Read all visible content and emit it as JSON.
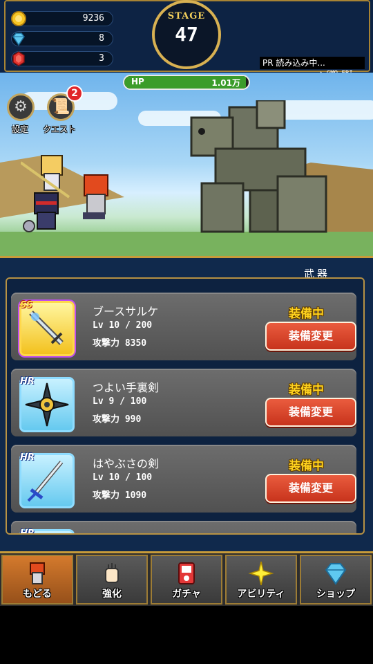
{
  "header": {
    "gold": "9236",
    "diamond": "8",
    "ruby": "3",
    "stage_label": "STAGE",
    "stage_number": "47",
    "pr_text": "PR 読み込み中...",
    "pr_logo": "▲ GMO-EBI"
  },
  "hp": {
    "label": "HP",
    "value": "1.01万",
    "fill_fraction": 0.98
  },
  "battle_buttons": {
    "settings_label": "設定",
    "quest_label": "クエスト",
    "quest_badge": "2"
  },
  "weapons_panel": {
    "title": "武器",
    "items": [
      {
        "rarity": "SS",
        "name": "ブースサルケ",
        "level": "Lv 10 / 200",
        "attack": "攻撃力 8350",
        "status": "装備中",
        "button": "装備変更"
      },
      {
        "rarity": "HR",
        "name": "つよい手裏剣",
        "level": "Lv 9 / 100",
        "attack": "攻撃力 990",
        "status": "装備中",
        "button": "装備変更"
      },
      {
        "rarity": "HR",
        "name": "はやぶさの剣",
        "level": "Lv 10 / 100",
        "attack": "攻撃力 1090",
        "status": "装備中",
        "button": "装備変更"
      },
      {
        "rarity": "HR",
        "name": "",
        "level": "",
        "attack": "",
        "status": "",
        "button": ""
      }
    ]
  },
  "nav": [
    {
      "label": "もどる",
      "icon": "hero-icon"
    },
    {
      "label": "強化",
      "icon": "fist-icon"
    },
    {
      "label": "ガチャ",
      "icon": "gacha-machine-icon"
    },
    {
      "label": "アビリティ",
      "icon": "sparkle-icon"
    },
    {
      "label": "ショップ",
      "icon": "diamond-icon"
    }
  ],
  "colors": {
    "panel_bg": "#10294c",
    "gold_trim": "#c79b3a",
    "button_red": "#d9482b",
    "equipped_yellow": "#ffd21e",
    "hp_green": "#3b9c2a"
  }
}
